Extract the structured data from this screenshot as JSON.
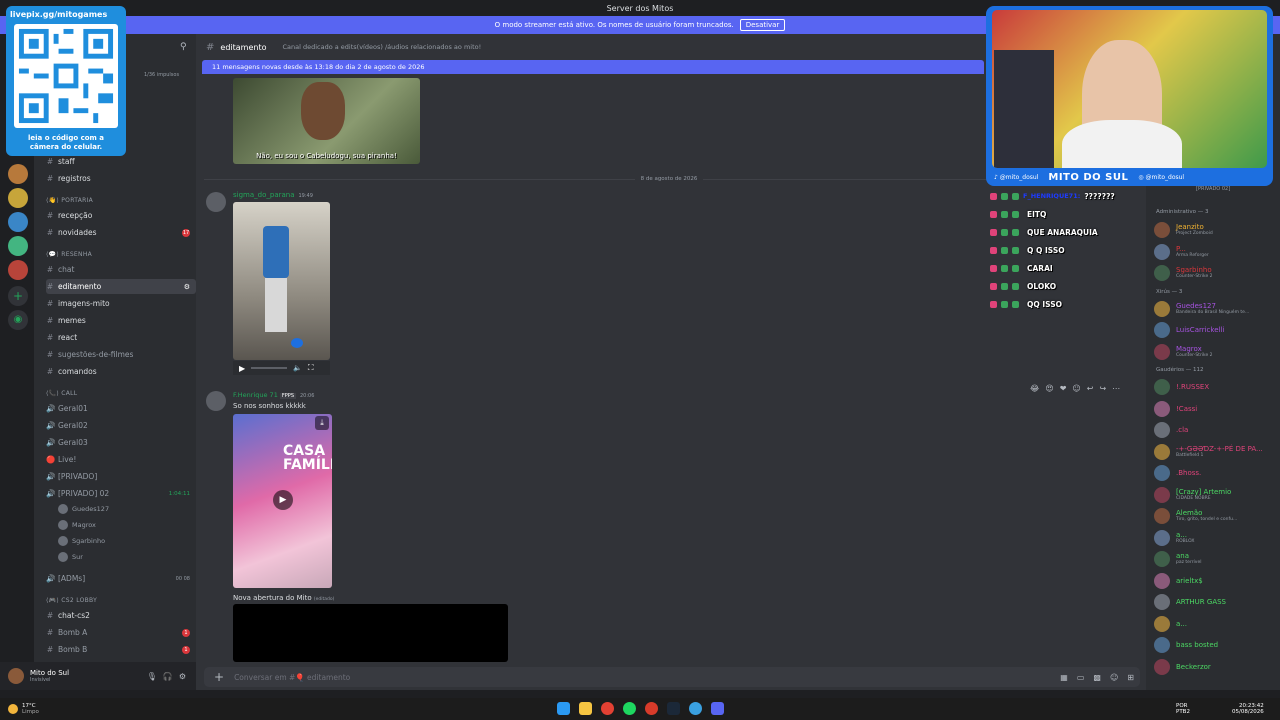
{
  "window": {
    "title": "Server dos Mitos"
  },
  "streamer_bar": {
    "text": "O modo streamer está ativo. Os nomes de usuário foram truncados.",
    "button": "Desativar"
  },
  "qr_overlay": {
    "url": "livepix.gg/mitogames",
    "caption": "leia o código com a câmera do celular."
  },
  "cam_overlay": {
    "tiktok": "@mito_dosul",
    "brand": "MITO DO SUL",
    "instagram": "@mito_dosul"
  },
  "stream_chat": [
    {
      "name": "F_HENRIQUE71:",
      "msg": "???????"
    },
    {
      "name": "",
      "msg": "EITQ"
    },
    {
      "name": "",
      "msg": "QUE ANARAQUIA"
    },
    {
      "name": "",
      "msg": "Q Q ISSO"
    },
    {
      "name": "",
      "msg": "CARAI"
    },
    {
      "name": "",
      "msg": "OLOKO"
    },
    {
      "name": "",
      "msg": "QQ ISSO"
    }
  ],
  "channel_header": {
    "name": "editamento",
    "topic": "Canal dedicado a edits(vídeos) /áudios relacionados ao mito!"
  },
  "new_messages_bar": "11 mensagens novas desde às 13:18 do dia 2 de agosto de 2026",
  "boosts": "1/36 impulsos",
  "sidebar": {
    "top_items": [
      {
        "label": "staff"
      },
      {
        "label": "registros"
      }
    ],
    "categories": [
      {
        "label": "PORTARIA",
        "channels": [
          {
            "label": "recepção",
            "badge": ""
          },
          {
            "label": "novidades",
            "badge": "17"
          }
        ]
      },
      {
        "label": "RESENHA",
        "channels": [
          {
            "label": "chat",
            "badge": ""
          },
          {
            "label": "editamento",
            "badge": ""
          },
          {
            "label": "imagens-mito",
            "badge": ""
          },
          {
            "label": "memes",
            "badge": ""
          },
          {
            "label": "react",
            "badge": ""
          },
          {
            "label": "sugestões-de-filmes",
            "badge": ""
          },
          {
            "label": "comandos",
            "badge": ""
          }
        ]
      },
      {
        "label": "CALL",
        "channels": [
          {
            "label": "Geral01"
          },
          {
            "label": "Geral02"
          },
          {
            "label": "Geral03"
          },
          {
            "label": "Live!"
          },
          {
            "label": "[PRIVADO]"
          },
          {
            "label": "[PRIVADO] 02",
            "timer": "1:04:11"
          }
        ],
        "voice_users": [
          "Guedes127",
          "Magrox",
          "Sgarbinho",
          "Sur"
        ],
        "adms": "[ADMs]",
        "adms_counts": [
          "00",
          "08"
        ]
      },
      {
        "label": "CS2 LOBBY",
        "channels": [
          {
            "label": "chat-cs2",
            "badge": ""
          },
          {
            "label": "Bomb A",
            "badge": "1"
          },
          {
            "label": "Bomb B",
            "badge": "1"
          }
        ]
      }
    ]
  },
  "user_panel": {
    "name": "Mito do Sul",
    "status": "Invisível"
  },
  "messages": {
    "image_caption": "Não, eu sou o Cabeludogu, sua piranha!",
    "date_divider": "8 de agosto de 2026",
    "msg1": {
      "author": "sigma_do_parana",
      "time": "19:49"
    },
    "msg2": {
      "author": "F.Henrique 71",
      "tag": "FPPS",
      "time": "20:06",
      "text": "So nos sonhos kkkkk"
    },
    "msg3": {
      "text": "Nova abertura  do Mito",
      "edited": "(editado)"
    },
    "video_title": "CASA FAMÍLIA"
  },
  "composer": {
    "placeholder": "Conversar em #🎈 editamento"
  },
  "members": {
    "top_status": "PRIVADO 02",
    "categories": [
      {
        "label": "Administrativo — 3",
        "members": [
          {
            "name": "Jeanzito",
            "sub": "Project Zomboid",
            "color": "#f0b232"
          },
          {
            "name": "P...",
            "sub": "Arma Reforger",
            "color": "#da373c"
          },
          {
            "name": "Sgarbinho",
            "sub": "Counter-Strike 2",
            "color": "#da373c"
          }
        ]
      },
      {
        "label": "Xirús — 3",
        "members": [
          {
            "name": "Guedes127",
            "sub": "Bandeira do Brasil Ninguém te...",
            "color": "#a653e0"
          },
          {
            "name": "LuisCarrickelli",
            "sub": "",
            "color": "#a653e0"
          },
          {
            "name": "Magrox",
            "sub": "Counter-Strike 2",
            "color": "#a653e0"
          }
        ]
      },
      {
        "label": "Gaudérios — 112",
        "members": [
          {
            "name": "!.RUSSEX",
            "sub": "",
            "color": "#e0437a"
          },
          {
            "name": "!Cassi",
            "sub": "",
            "color": "#e0437a"
          },
          {
            "name": ".cla",
            "sub": "",
            "color": "#e0437a"
          },
          {
            "name": "-+-ǤƏƏƊZ-+-PÉ DE PA...",
            "sub": "Battlefield 1",
            "color": "#e0437a"
          },
          {
            "name": ".Bhoss.",
            "sub": "",
            "color": "#e0437a"
          },
          {
            "name": "[Crazy] Artemio",
            "sub": "CIDADE NOBRE",
            "color": "#4cd964"
          },
          {
            "name": "Alemão",
            "sub": "Tiro, grito, tondel e confu...",
            "color": "#4cd964"
          },
          {
            "name": "a...",
            "sub": "ROBLOX",
            "color": "#4cd964"
          },
          {
            "name": "ana",
            "sub": "paz terrível",
            "color": "#4cd964"
          },
          {
            "name": "arieltx$",
            "sub": "",
            "color": "#4cd964"
          },
          {
            "name": "ARTHUR GASS",
            "sub": "",
            "color": "#4cd964"
          },
          {
            "name": "a...",
            "sub": "",
            "color": "#4cd964"
          },
          {
            "name": "bass bosted",
            "sub": "",
            "color": "#4cd964"
          },
          {
            "name": "Beckerzor",
            "sub": "",
            "color": "#4cd964"
          }
        ]
      }
    ]
  },
  "taskbar": {
    "weather_temp": "17°C",
    "weather_desc": "Limpo",
    "lang": "POR",
    "layout": "PTB2",
    "time": "20:23:42",
    "date": "05/08/2026"
  },
  "colors": {
    "accent": "#5865f2",
    "bg": "#313338",
    "sidebar": "#2b2d31",
    "danger": "#da373c"
  }
}
